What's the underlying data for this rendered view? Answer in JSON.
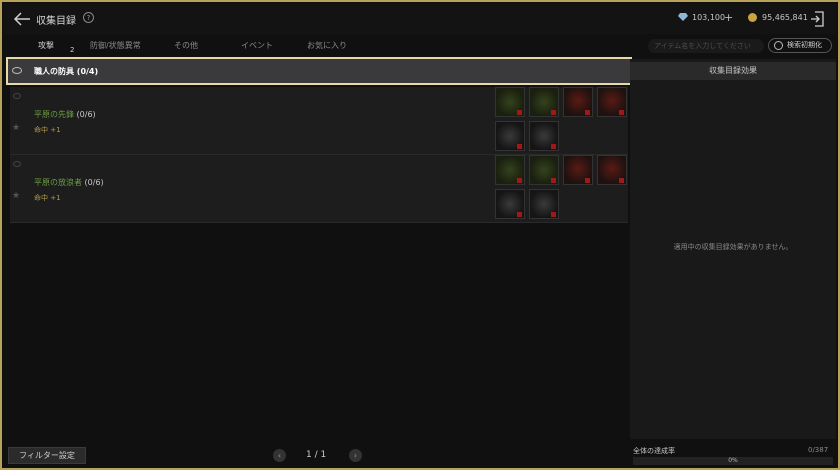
{
  "header": {
    "title": "収集目録",
    "help_glyph": "?",
    "diamonds": "103,100",
    "plus": "+",
    "gold": "95,465,841"
  },
  "tabs": [
    {
      "label": "攻撃",
      "active": true
    },
    {
      "label": "防御/状態異常",
      "active": false
    },
    {
      "label": "その他",
      "active": false
    },
    {
      "label": "イベント",
      "active": false
    },
    {
      "label": "お気に入り",
      "active": false
    }
  ],
  "tab_badge": "2",
  "search": {
    "placeholder": "アイテム名を入力してください",
    "reset_label": "検索初期化"
  },
  "group": {
    "label": "職人の防具 (0/4)"
  },
  "items": [
    {
      "name": "平原の先鋒",
      "count": "(0/6)",
      "stat": "命中 +1"
    },
    {
      "name": "平原の放浪者",
      "count": "(0/6)",
      "stat": "命中 +1"
    }
  ],
  "right_panel": {
    "title": "収集目録効果",
    "empty": "適用中の収集目録効果がありません。"
  },
  "footer": {
    "filter": "フィルター設定",
    "prev": "‹",
    "next": "›",
    "page": "1 / 1",
    "total_label": "全体の達成率",
    "total_count": "0/387",
    "progress_text": "0%",
    "progress": 0
  },
  "colors": {
    "accent_border": "#e9d9a6",
    "item_name": "#6a9b3f",
    "stat": "#b39a4c",
    "frame": "#b8a25a"
  },
  "icons": [
    "back-arrow-icon",
    "help-icon",
    "diamond-icon",
    "gold-coin-icon",
    "exit-icon",
    "eye-icon",
    "star-icon",
    "reset-icon"
  ]
}
